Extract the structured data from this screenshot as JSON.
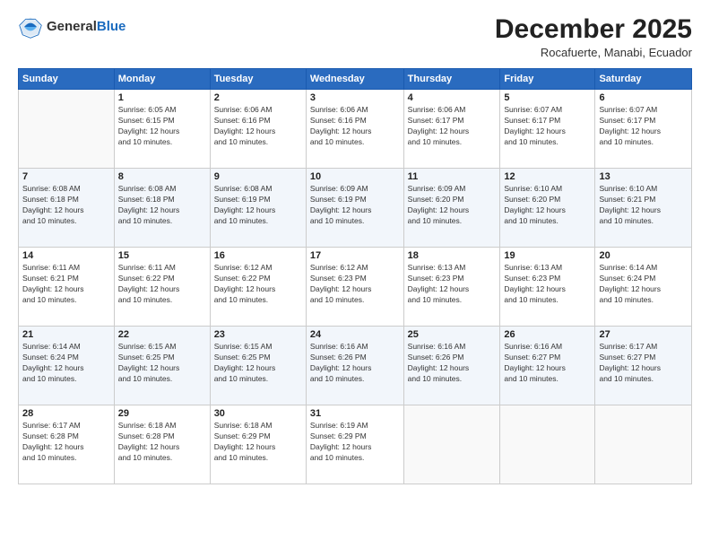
{
  "header": {
    "logo_general": "General",
    "logo_blue": "Blue",
    "title": "December 2025",
    "location": "Rocafuerte, Manabi, Ecuador"
  },
  "days_of_week": [
    "Sunday",
    "Monday",
    "Tuesday",
    "Wednesday",
    "Thursday",
    "Friday",
    "Saturday"
  ],
  "weeks": [
    [
      {
        "day": "",
        "info": ""
      },
      {
        "day": "1",
        "info": "Sunrise: 6:05 AM\nSunset: 6:15 PM\nDaylight: 12 hours\nand 10 minutes."
      },
      {
        "day": "2",
        "info": "Sunrise: 6:06 AM\nSunset: 6:16 PM\nDaylight: 12 hours\nand 10 minutes."
      },
      {
        "day": "3",
        "info": "Sunrise: 6:06 AM\nSunset: 6:16 PM\nDaylight: 12 hours\nand 10 minutes."
      },
      {
        "day": "4",
        "info": "Sunrise: 6:06 AM\nSunset: 6:17 PM\nDaylight: 12 hours\nand 10 minutes."
      },
      {
        "day": "5",
        "info": "Sunrise: 6:07 AM\nSunset: 6:17 PM\nDaylight: 12 hours\nand 10 minutes."
      },
      {
        "day": "6",
        "info": "Sunrise: 6:07 AM\nSunset: 6:17 PM\nDaylight: 12 hours\nand 10 minutes."
      }
    ],
    [
      {
        "day": "7",
        "info": "Sunrise: 6:08 AM\nSunset: 6:18 PM\nDaylight: 12 hours\nand 10 minutes."
      },
      {
        "day": "8",
        "info": "Sunrise: 6:08 AM\nSunset: 6:18 PM\nDaylight: 12 hours\nand 10 minutes."
      },
      {
        "day": "9",
        "info": "Sunrise: 6:08 AM\nSunset: 6:19 PM\nDaylight: 12 hours\nand 10 minutes."
      },
      {
        "day": "10",
        "info": "Sunrise: 6:09 AM\nSunset: 6:19 PM\nDaylight: 12 hours\nand 10 minutes."
      },
      {
        "day": "11",
        "info": "Sunrise: 6:09 AM\nSunset: 6:20 PM\nDaylight: 12 hours\nand 10 minutes."
      },
      {
        "day": "12",
        "info": "Sunrise: 6:10 AM\nSunset: 6:20 PM\nDaylight: 12 hours\nand 10 minutes."
      },
      {
        "day": "13",
        "info": "Sunrise: 6:10 AM\nSunset: 6:21 PM\nDaylight: 12 hours\nand 10 minutes."
      }
    ],
    [
      {
        "day": "14",
        "info": "Sunrise: 6:11 AM\nSunset: 6:21 PM\nDaylight: 12 hours\nand 10 minutes."
      },
      {
        "day": "15",
        "info": "Sunrise: 6:11 AM\nSunset: 6:22 PM\nDaylight: 12 hours\nand 10 minutes."
      },
      {
        "day": "16",
        "info": "Sunrise: 6:12 AM\nSunset: 6:22 PM\nDaylight: 12 hours\nand 10 minutes."
      },
      {
        "day": "17",
        "info": "Sunrise: 6:12 AM\nSunset: 6:23 PM\nDaylight: 12 hours\nand 10 minutes."
      },
      {
        "day": "18",
        "info": "Sunrise: 6:13 AM\nSunset: 6:23 PM\nDaylight: 12 hours\nand 10 minutes."
      },
      {
        "day": "19",
        "info": "Sunrise: 6:13 AM\nSunset: 6:23 PM\nDaylight: 12 hours\nand 10 minutes."
      },
      {
        "day": "20",
        "info": "Sunrise: 6:14 AM\nSunset: 6:24 PM\nDaylight: 12 hours\nand 10 minutes."
      }
    ],
    [
      {
        "day": "21",
        "info": "Sunrise: 6:14 AM\nSunset: 6:24 PM\nDaylight: 12 hours\nand 10 minutes."
      },
      {
        "day": "22",
        "info": "Sunrise: 6:15 AM\nSunset: 6:25 PM\nDaylight: 12 hours\nand 10 minutes."
      },
      {
        "day": "23",
        "info": "Sunrise: 6:15 AM\nSunset: 6:25 PM\nDaylight: 12 hours\nand 10 minutes."
      },
      {
        "day": "24",
        "info": "Sunrise: 6:16 AM\nSunset: 6:26 PM\nDaylight: 12 hours\nand 10 minutes."
      },
      {
        "day": "25",
        "info": "Sunrise: 6:16 AM\nSunset: 6:26 PM\nDaylight: 12 hours\nand 10 minutes."
      },
      {
        "day": "26",
        "info": "Sunrise: 6:16 AM\nSunset: 6:27 PM\nDaylight: 12 hours\nand 10 minutes."
      },
      {
        "day": "27",
        "info": "Sunrise: 6:17 AM\nSunset: 6:27 PM\nDaylight: 12 hours\nand 10 minutes."
      }
    ],
    [
      {
        "day": "28",
        "info": "Sunrise: 6:17 AM\nSunset: 6:28 PM\nDaylight: 12 hours\nand 10 minutes."
      },
      {
        "day": "29",
        "info": "Sunrise: 6:18 AM\nSunset: 6:28 PM\nDaylight: 12 hours\nand 10 minutes."
      },
      {
        "day": "30",
        "info": "Sunrise: 6:18 AM\nSunset: 6:29 PM\nDaylight: 12 hours\nand 10 minutes."
      },
      {
        "day": "31",
        "info": "Sunrise: 6:19 AM\nSunset: 6:29 PM\nDaylight: 12 hours\nand 10 minutes."
      },
      {
        "day": "",
        "info": ""
      },
      {
        "day": "",
        "info": ""
      },
      {
        "day": "",
        "info": ""
      }
    ]
  ]
}
